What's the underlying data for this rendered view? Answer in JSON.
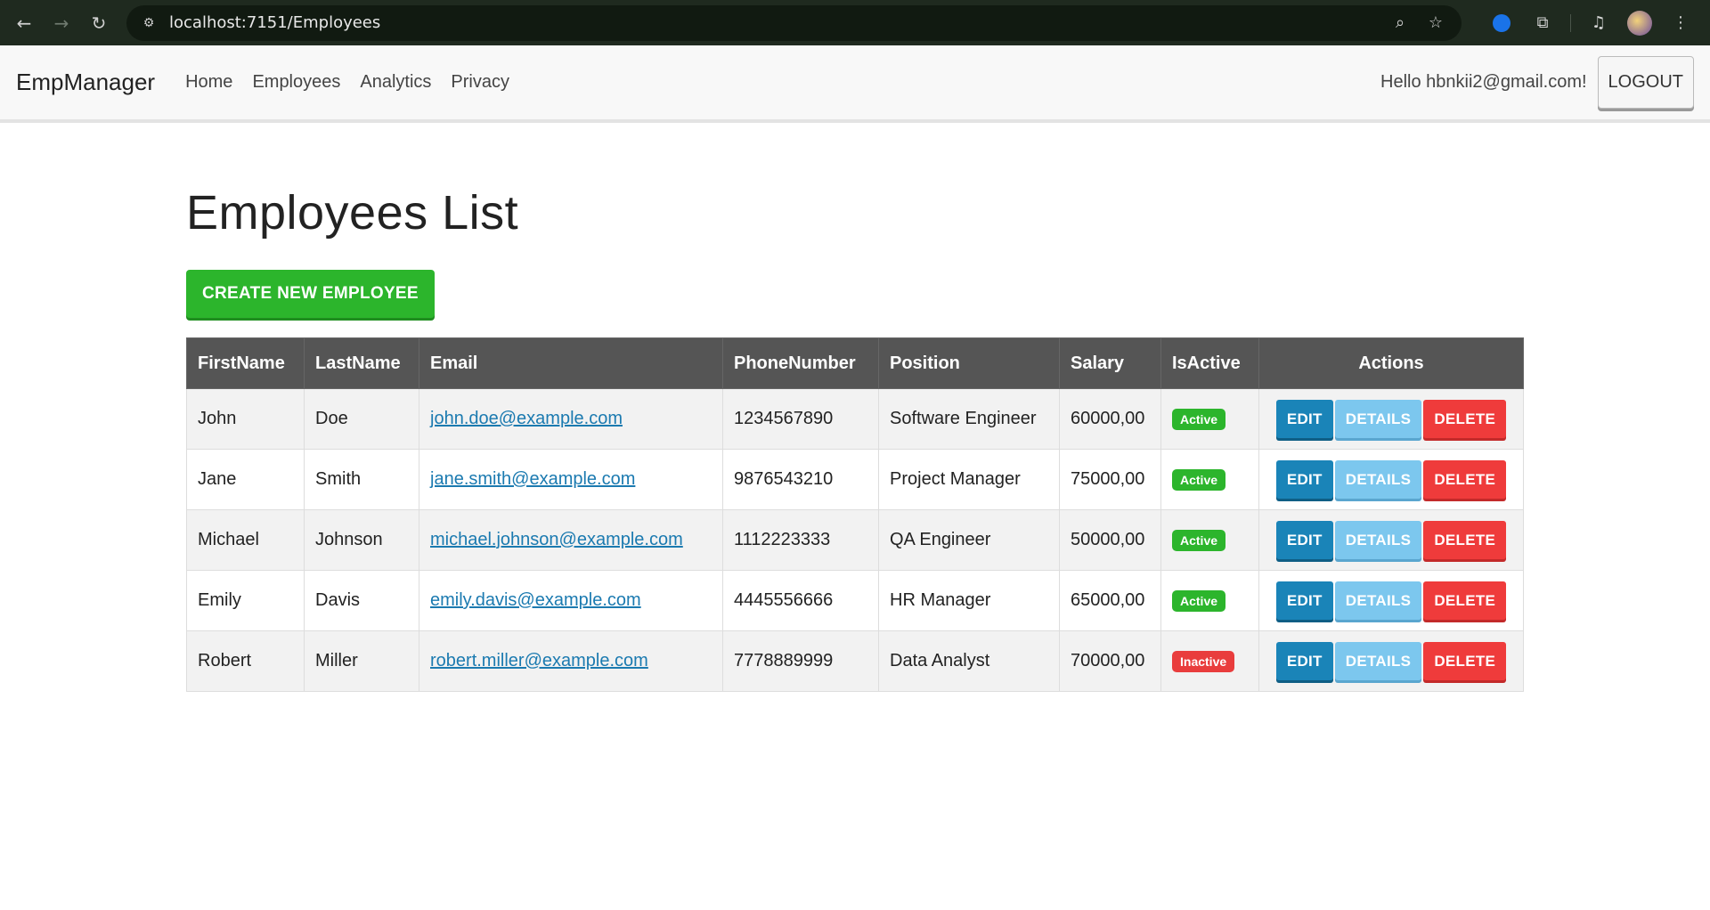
{
  "browser": {
    "url": "localhost:7151/Employees"
  },
  "navbar": {
    "brand": "EmpManager",
    "links": [
      "Home",
      "Employees",
      "Analytics",
      "Privacy"
    ],
    "greeting": "Hello hbnkii2@gmail.com!",
    "logout_label": "LOGOUT"
  },
  "main": {
    "title": "Employees List",
    "create_label": "CREATE NEW EMPLOYEE",
    "table": {
      "headers": [
        "FirstName",
        "LastName",
        "Email",
        "PhoneNumber",
        "Position",
        "Salary",
        "IsActive",
        "Actions"
      ],
      "rows": [
        {
          "first": "John",
          "last": "Doe",
          "email": "john.doe@example.com",
          "phone": "1234567890",
          "position": "Software Engineer",
          "salary": "60000,00",
          "status": "Active"
        },
        {
          "first": "Jane",
          "last": "Smith",
          "email": "jane.smith@example.com",
          "phone": "9876543210",
          "position": "Project Manager",
          "salary": "75000,00",
          "status": "Active"
        },
        {
          "first": "Michael",
          "last": "Johnson",
          "email": "michael.johnson@example.com",
          "phone": "1112223333",
          "position": "QA Engineer",
          "salary": "50000,00",
          "status": "Active"
        },
        {
          "first": "Emily",
          "last": "Davis",
          "email": "emily.davis@example.com",
          "phone": "4445556666",
          "position": "HR Manager",
          "salary": "65000,00",
          "status": "Active"
        },
        {
          "first": "Robert",
          "last": "Miller",
          "email": "robert.miller@example.com",
          "phone": "7778889999",
          "position": "Data Analyst",
          "salary": "70000,00",
          "status": "Inactive"
        }
      ],
      "action_labels": {
        "edit": "EDIT",
        "details": "DETAILS",
        "delete": "DELETE"
      }
    }
  },
  "colors": {
    "create": "#2cb52c",
    "edit": "#1a84b8",
    "details": "#7cc7ee",
    "delete": "#ef3b3b",
    "header_bg": "#555555"
  }
}
